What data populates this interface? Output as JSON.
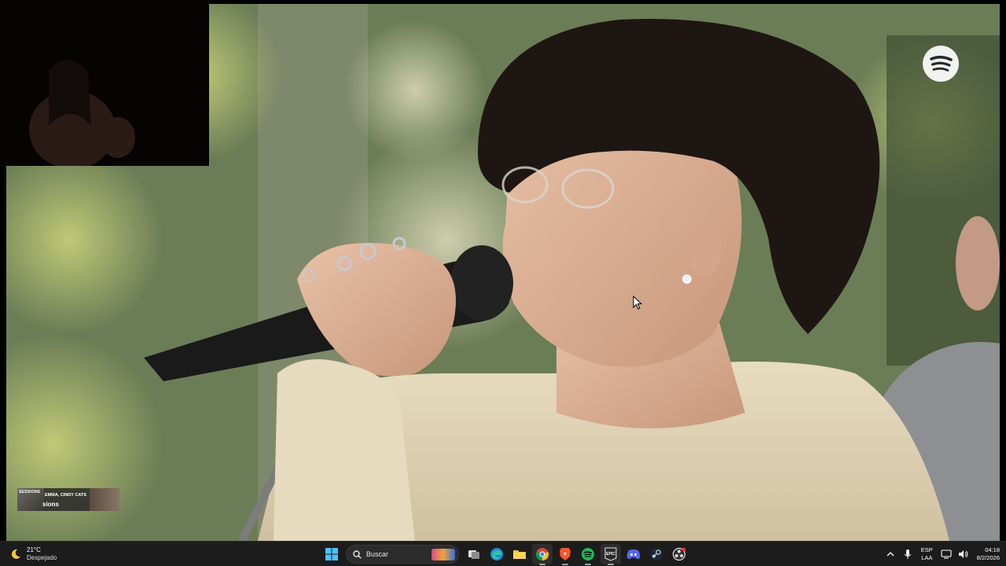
{
  "video": {
    "logo_icon": "spotify-icon",
    "accent": "#1db954"
  },
  "now_playing": {
    "badge": "SESSIONS",
    "artist": "EMMA, CINDY CATS",
    "title": "sions"
  },
  "taskbar": {
    "weather": {
      "temperature": "21°C",
      "condition": "Despejado",
      "icon": "moon-icon"
    },
    "search": {
      "placeholder": "Buscar"
    },
    "apps": [
      {
        "name": "windows-start-icon"
      },
      {
        "name": "task-view-icon"
      },
      {
        "name": "edge-icon"
      },
      {
        "name": "file-explorer-icon"
      },
      {
        "name": "chrome-icon"
      },
      {
        "name": "brave-icon"
      },
      {
        "name": "spotify-icon"
      },
      {
        "name": "epic-games-icon"
      },
      {
        "name": "discord-icon"
      },
      {
        "name": "steam-icon"
      },
      {
        "name": "obs-icon"
      }
    ],
    "language": {
      "code": "ESP",
      "layout": "LAA"
    },
    "clock": {
      "time": "04:18",
      "date": "8/2/2026"
    }
  }
}
